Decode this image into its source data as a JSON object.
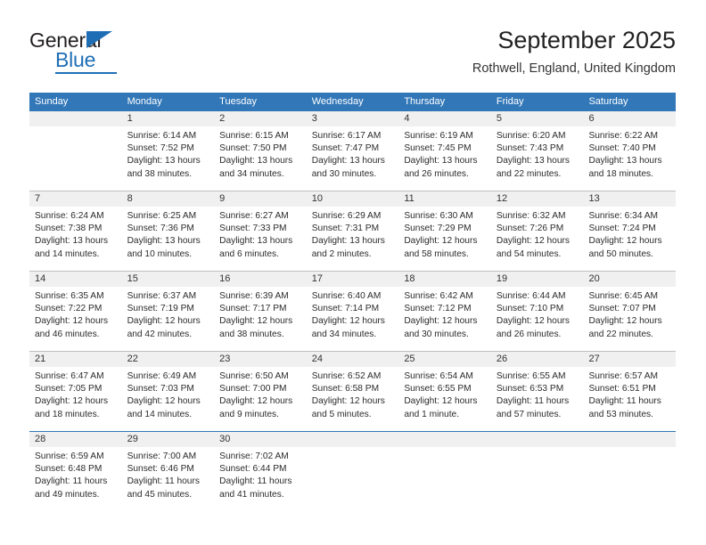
{
  "logo": {
    "text_primary": "General",
    "text_secondary": "Blue",
    "brand_color": "#1f6eb5"
  },
  "header": {
    "title": "September 2025",
    "subtitle": "Rothwell, England, United Kingdom"
  },
  "theme": {
    "header_row_bg": "#3277b8",
    "daynum_band_bg": "#f0f0f0",
    "grid_line": "#bfbfbf",
    "accent_rule": "#3277b8",
    "text": "#2b2b2b"
  },
  "weekdays": [
    "Sunday",
    "Monday",
    "Tuesday",
    "Wednesday",
    "Thursday",
    "Friday",
    "Saturday"
  ],
  "weeks": [
    {
      "days": [
        {
          "num": "",
          "lines": []
        },
        {
          "num": "1",
          "lines": [
            "Sunrise: 6:14 AM",
            "Sunset: 7:52 PM",
            "Daylight: 13 hours",
            "and 38 minutes."
          ]
        },
        {
          "num": "2",
          "lines": [
            "Sunrise: 6:15 AM",
            "Sunset: 7:50 PM",
            "Daylight: 13 hours",
            "and 34 minutes."
          ]
        },
        {
          "num": "3",
          "lines": [
            "Sunrise: 6:17 AM",
            "Sunset: 7:47 PM",
            "Daylight: 13 hours",
            "and 30 minutes."
          ]
        },
        {
          "num": "4",
          "lines": [
            "Sunrise: 6:19 AM",
            "Sunset: 7:45 PM",
            "Daylight: 13 hours",
            "and 26 minutes."
          ]
        },
        {
          "num": "5",
          "lines": [
            "Sunrise: 6:20 AM",
            "Sunset: 7:43 PM",
            "Daylight: 13 hours",
            "and 22 minutes."
          ]
        },
        {
          "num": "6",
          "lines": [
            "Sunrise: 6:22 AM",
            "Sunset: 7:40 PM",
            "Daylight: 13 hours",
            "and 18 minutes."
          ]
        }
      ]
    },
    {
      "days": [
        {
          "num": "7",
          "lines": [
            "Sunrise: 6:24 AM",
            "Sunset: 7:38 PM",
            "Daylight: 13 hours",
            "and 14 minutes."
          ]
        },
        {
          "num": "8",
          "lines": [
            "Sunrise: 6:25 AM",
            "Sunset: 7:36 PM",
            "Daylight: 13 hours",
            "and 10 minutes."
          ]
        },
        {
          "num": "9",
          "lines": [
            "Sunrise: 6:27 AM",
            "Sunset: 7:33 PM",
            "Daylight: 13 hours",
            "and 6 minutes."
          ]
        },
        {
          "num": "10",
          "lines": [
            "Sunrise: 6:29 AM",
            "Sunset: 7:31 PM",
            "Daylight: 13 hours",
            "and 2 minutes."
          ]
        },
        {
          "num": "11",
          "lines": [
            "Sunrise: 6:30 AM",
            "Sunset: 7:29 PM",
            "Daylight: 12 hours",
            "and 58 minutes."
          ]
        },
        {
          "num": "12",
          "lines": [
            "Sunrise: 6:32 AM",
            "Sunset: 7:26 PM",
            "Daylight: 12 hours",
            "and 54 minutes."
          ]
        },
        {
          "num": "13",
          "lines": [
            "Sunrise: 6:34 AM",
            "Sunset: 7:24 PM",
            "Daylight: 12 hours",
            "and 50 minutes."
          ]
        }
      ]
    },
    {
      "days": [
        {
          "num": "14",
          "lines": [
            "Sunrise: 6:35 AM",
            "Sunset: 7:22 PM",
            "Daylight: 12 hours",
            "and 46 minutes."
          ]
        },
        {
          "num": "15",
          "lines": [
            "Sunrise: 6:37 AM",
            "Sunset: 7:19 PM",
            "Daylight: 12 hours",
            "and 42 minutes."
          ]
        },
        {
          "num": "16",
          "lines": [
            "Sunrise: 6:39 AM",
            "Sunset: 7:17 PM",
            "Daylight: 12 hours",
            "and 38 minutes."
          ]
        },
        {
          "num": "17",
          "lines": [
            "Sunrise: 6:40 AM",
            "Sunset: 7:14 PM",
            "Daylight: 12 hours",
            "and 34 minutes."
          ]
        },
        {
          "num": "18",
          "lines": [
            "Sunrise: 6:42 AM",
            "Sunset: 7:12 PM",
            "Daylight: 12 hours",
            "and 30 minutes."
          ]
        },
        {
          "num": "19",
          "lines": [
            "Sunrise: 6:44 AM",
            "Sunset: 7:10 PM",
            "Daylight: 12 hours",
            "and 26 minutes."
          ]
        },
        {
          "num": "20",
          "lines": [
            "Sunrise: 6:45 AM",
            "Sunset: 7:07 PM",
            "Daylight: 12 hours",
            "and 22 minutes."
          ]
        }
      ]
    },
    {
      "days": [
        {
          "num": "21",
          "lines": [
            "Sunrise: 6:47 AM",
            "Sunset: 7:05 PM",
            "Daylight: 12 hours",
            "and 18 minutes."
          ]
        },
        {
          "num": "22",
          "lines": [
            "Sunrise: 6:49 AM",
            "Sunset: 7:03 PM",
            "Daylight: 12 hours",
            "and 14 minutes."
          ]
        },
        {
          "num": "23",
          "lines": [
            "Sunrise: 6:50 AM",
            "Sunset: 7:00 PM",
            "Daylight: 12 hours",
            "and 9 minutes."
          ]
        },
        {
          "num": "24",
          "lines": [
            "Sunrise: 6:52 AM",
            "Sunset: 6:58 PM",
            "Daylight: 12 hours",
            "and 5 minutes."
          ]
        },
        {
          "num": "25",
          "lines": [
            "Sunrise: 6:54 AM",
            "Sunset: 6:55 PM",
            "Daylight: 12 hours",
            "and 1 minute."
          ]
        },
        {
          "num": "26",
          "lines": [
            "Sunrise: 6:55 AM",
            "Sunset: 6:53 PM",
            "Daylight: 11 hours",
            "and 57 minutes."
          ]
        },
        {
          "num": "27",
          "lines": [
            "Sunrise: 6:57 AM",
            "Sunset: 6:51 PM",
            "Daylight: 11 hours",
            "and 53 minutes."
          ]
        }
      ]
    },
    {
      "days": [
        {
          "num": "28",
          "lines": [
            "Sunrise: 6:59 AM",
            "Sunset: 6:48 PM",
            "Daylight: 11 hours",
            "and 49 minutes."
          ]
        },
        {
          "num": "29",
          "lines": [
            "Sunrise: 7:00 AM",
            "Sunset: 6:46 PM",
            "Daylight: 11 hours",
            "and 45 minutes."
          ]
        },
        {
          "num": "30",
          "lines": [
            "Sunrise: 7:02 AM",
            "Sunset: 6:44 PM",
            "Daylight: 11 hours",
            "and 41 minutes."
          ]
        },
        {
          "num": "",
          "lines": []
        },
        {
          "num": "",
          "lines": []
        },
        {
          "num": "",
          "lines": []
        },
        {
          "num": "",
          "lines": []
        }
      ]
    }
  ]
}
